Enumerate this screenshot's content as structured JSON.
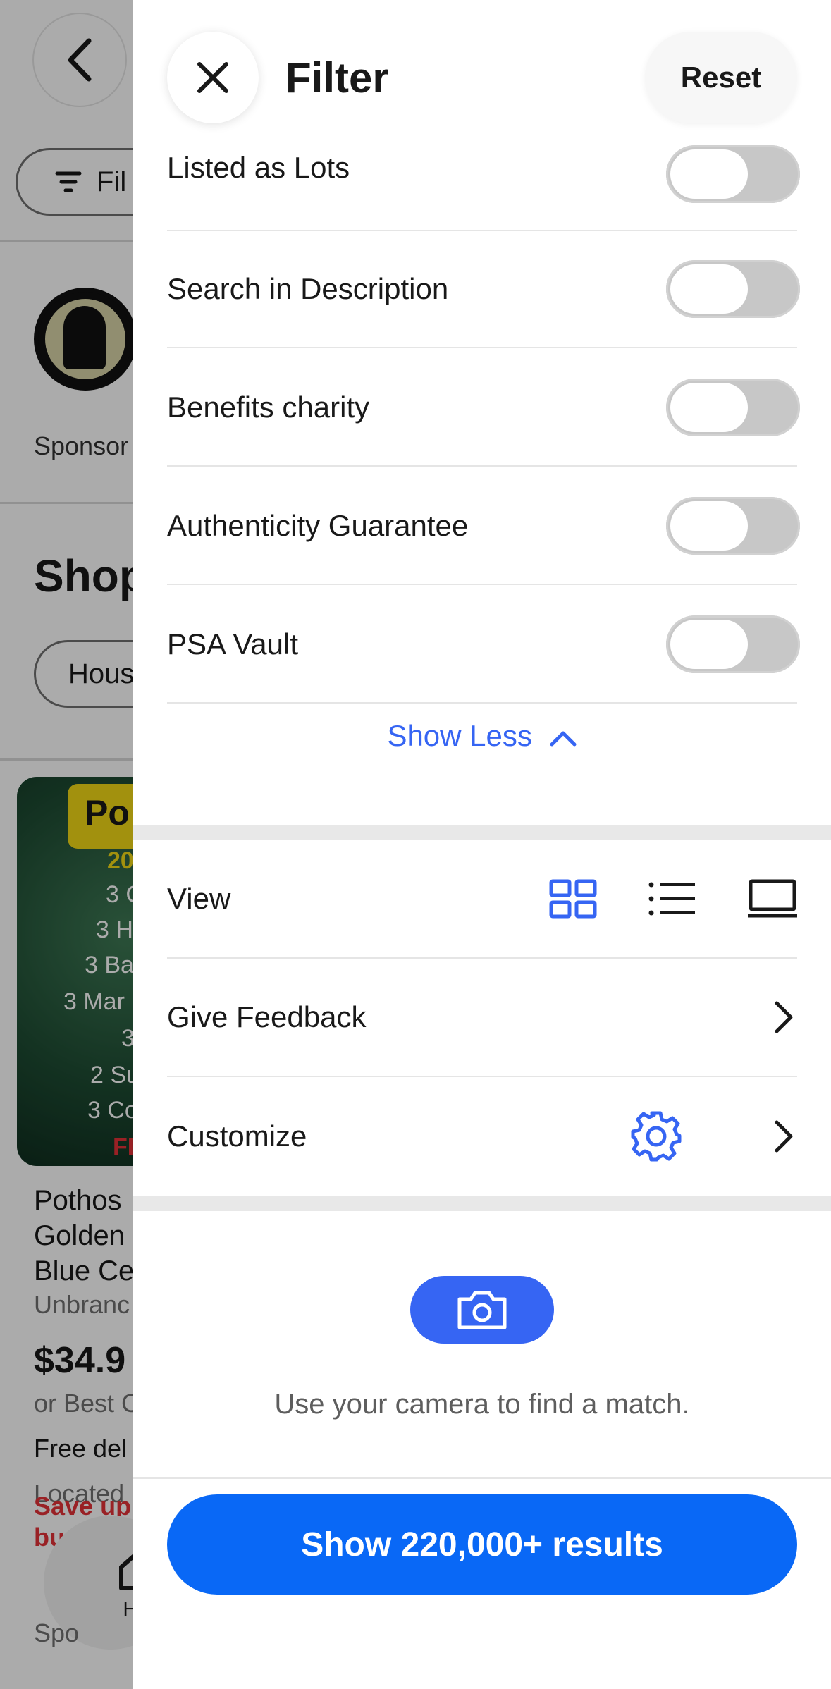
{
  "background": {
    "filter_chip_label": "Fil",
    "sponsored": "Sponsor",
    "shop_heading": "Shop",
    "category_chip": "Hous",
    "product": {
      "image_tag": "Po",
      "image_lines": [
        "20",
        "3 C",
        "3 H",
        "3 Ba",
        "3 Mar",
        "3",
        "2 Su",
        "3 Co",
        "FI"
      ],
      "title_lines": [
        "Pothos",
        "Golden",
        "Blue Ce"
      ],
      "brand": "Unbranc",
      "price": "$34.9",
      "best_offer": "or Best C",
      "delivery": "Free del",
      "located": "Located",
      "save": "Save up",
      "save2": "bu"
    },
    "home_label": "Hor",
    "bottom_text": "Spo"
  },
  "panel": {
    "title": "Filter",
    "reset_label": "Reset",
    "toggles": [
      {
        "label": "Listed as Lots",
        "on": false
      },
      {
        "label": "Search in Description",
        "on": false
      },
      {
        "label": "Benefits charity",
        "on": false
      },
      {
        "label": "Authenticity Guarantee",
        "on": false
      },
      {
        "label": "PSA Vault",
        "on": false
      }
    ],
    "show_less_label": "Show Less",
    "view_label": "View",
    "view_options": [
      "grid-view-icon",
      "list-view-icon",
      "gallery-view-icon"
    ],
    "view_selected": "grid-view-icon",
    "feedback_label": "Give Feedback",
    "customize_label": "Customize",
    "camera_text": "Use your camera to find a match.",
    "results_button": "Show 220,000+ results"
  },
  "colors": {
    "accent": "#3665f3",
    "primary_button": "#0968f6",
    "toggle_off": "#c7c7c7"
  }
}
